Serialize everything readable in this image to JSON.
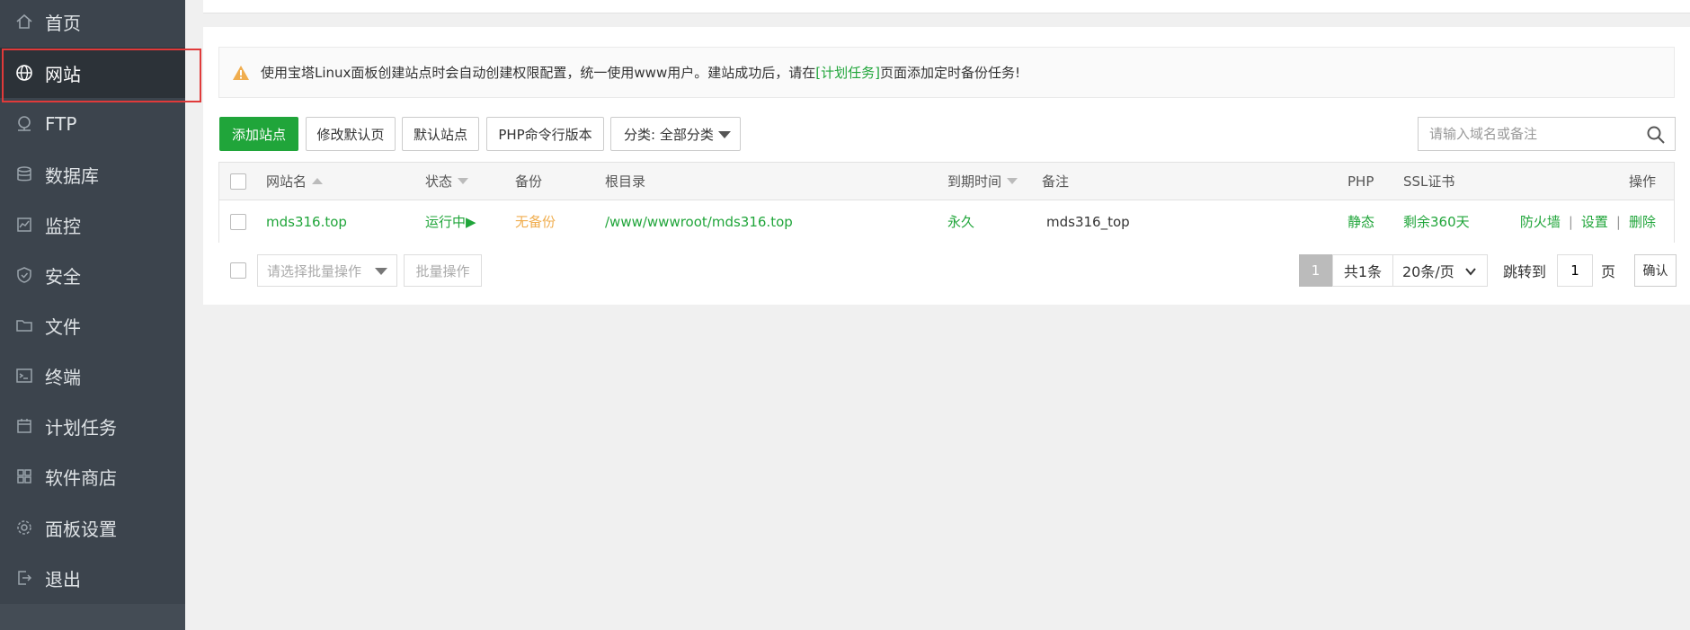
{
  "sidebar": {
    "items": [
      {
        "label": "首页",
        "icon": "home-icon"
      },
      {
        "label": "网站",
        "icon": "globe-icon"
      },
      {
        "label": "FTP",
        "icon": "ftp-icon"
      },
      {
        "label": "数据库",
        "icon": "database-icon"
      },
      {
        "label": "监控",
        "icon": "monitor-icon"
      },
      {
        "label": "安全",
        "icon": "shield-icon"
      },
      {
        "label": "文件",
        "icon": "folder-icon"
      },
      {
        "label": "终端",
        "icon": "terminal-icon"
      },
      {
        "label": "计划任务",
        "icon": "calendar-icon"
      },
      {
        "label": "软件商店",
        "icon": "apps-icon"
      },
      {
        "label": "面板设置",
        "icon": "gear-icon"
      },
      {
        "label": "退出",
        "icon": "logout-icon"
      }
    ],
    "active_index": 1
  },
  "notice": {
    "prefix": "使用宝塔Linux面板创建站点时会自动创建权限配置，统一使用www用户。建站成功后，请在",
    "link": "[计划任务]",
    "suffix": "页面添加定时备份任务!"
  },
  "toolbar": {
    "add_site": "添加站点",
    "edit_default_page": "修改默认页",
    "default_site": "默认站点",
    "php_cli_version": "PHP命令行版本",
    "category": "分类: 全部分类",
    "search_placeholder": "请输入域名或备注"
  },
  "table": {
    "headers": {
      "name": "网站名",
      "status": "状态",
      "backup": "备份",
      "root": "根目录",
      "expire": "到期时间",
      "remark": "备注",
      "php": "PHP",
      "ssl": "SSL证书",
      "actions": "操作"
    },
    "rows": [
      {
        "name": "mds316.top",
        "status": "运行中▶",
        "backup": "无备份",
        "root": "/www/wwwroot/mds316.top",
        "expire": "永久",
        "remark": "mds316_top",
        "php": "静态",
        "ssl": "剩余360天",
        "action_firewall": "防火墙",
        "action_settings": "设置",
        "action_delete": "删除",
        "separator": "|"
      }
    ]
  },
  "footer": {
    "batch_placeholder": "请选择批量操作",
    "batch_button": "批量操作",
    "current_page": "1",
    "total": "共1条",
    "page_size": "20条/页",
    "jump_label": "跳转到",
    "jump_value": "1",
    "page_unit": "页",
    "confirm": "确认"
  },
  "colors": {
    "sidebar_bg": "#3c444d",
    "accent_green": "#20a53a",
    "warning_orange": "#f0ad4e",
    "highlight_red": "#e03a3a"
  }
}
